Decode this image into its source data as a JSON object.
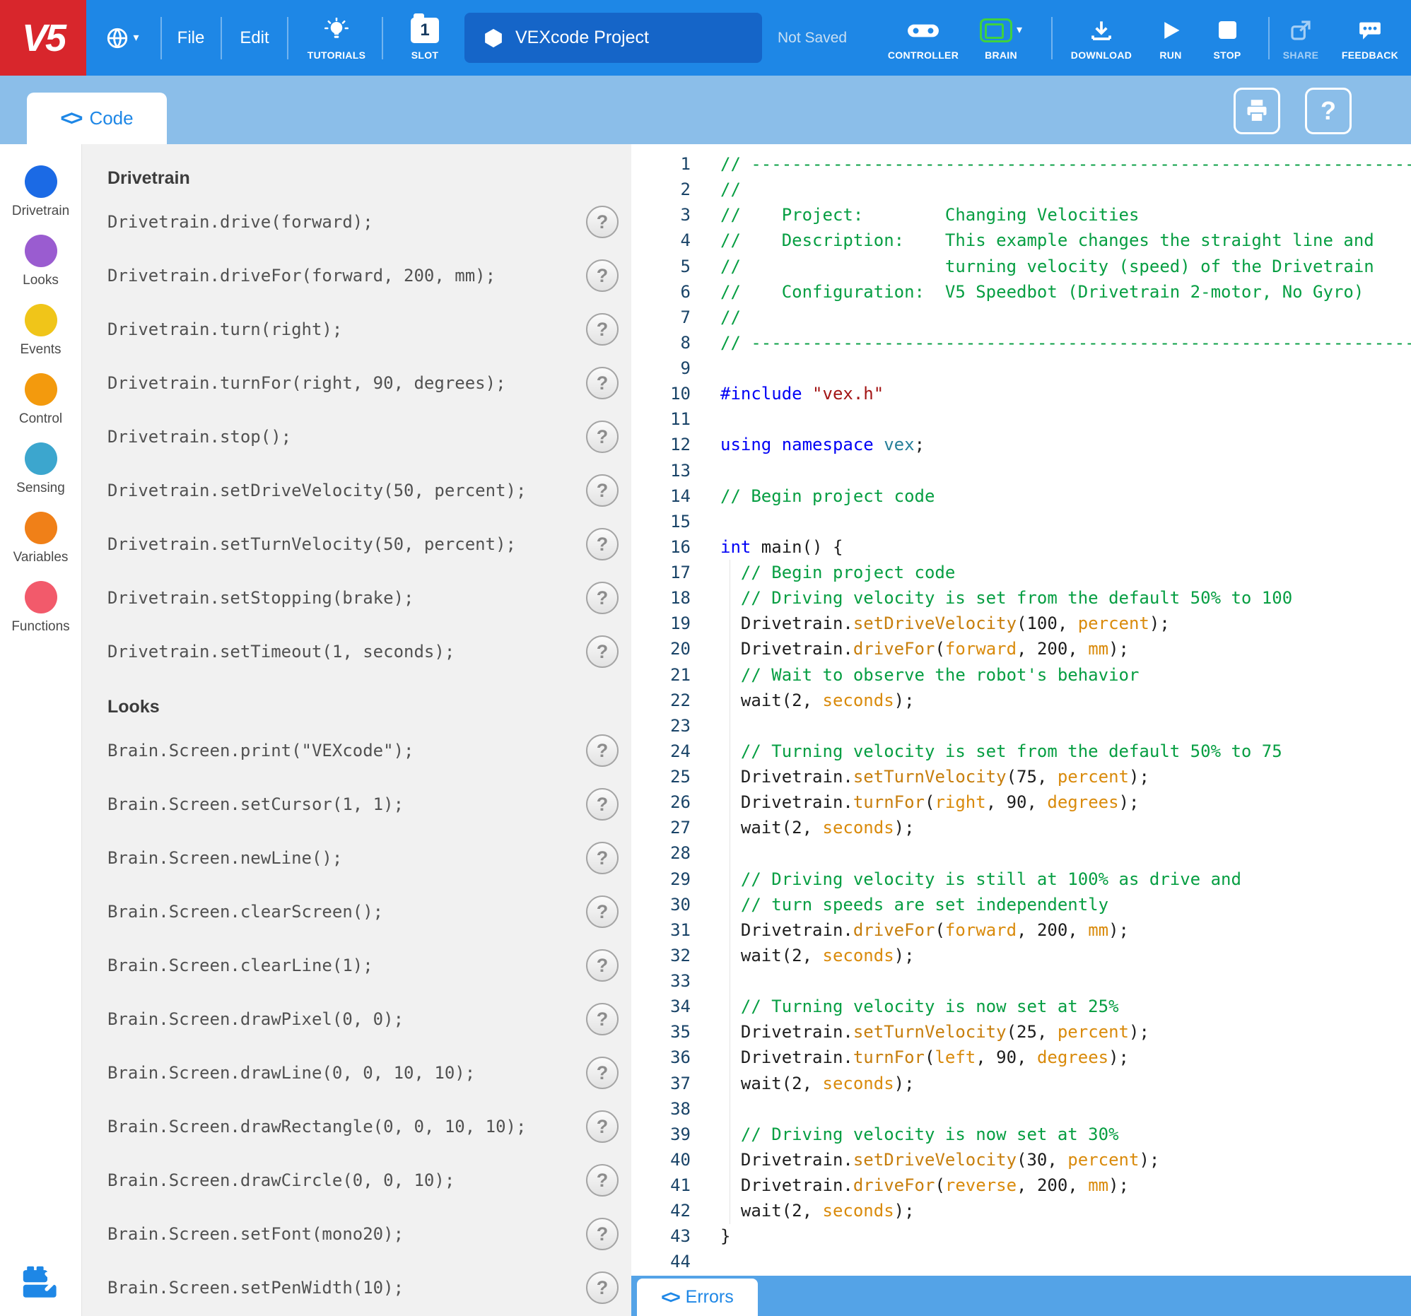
{
  "colors": {
    "toolbar_blue": "#1E87E6",
    "logo_red": "#D8262C",
    "project_box_blue": "#1565C8",
    "subbar_blue": "#8BBEE9",
    "errors_bar_blue": "#54A3E7",
    "brain_green": "#3FD23F",
    "accent_blue": "#1E87E6"
  },
  "toolbar": {
    "logo_text": "V5",
    "file_menu": "File",
    "edit_menu": "Edit",
    "tutorials_label": "TUTORIALS",
    "slot_label": "SLOT",
    "slot_number": "1",
    "project_title": "VEXcode Project",
    "save_status": "Not Saved",
    "controller_label": "CONTROLLER",
    "brain_label": "BRAIN",
    "download_label": "DOWNLOAD",
    "run_label": "RUN",
    "stop_label": "STOP",
    "share_label": "SHARE",
    "feedback_label": "FEEDBACK"
  },
  "workspace_bar": {
    "code_tab_label": "Code"
  },
  "icons": {
    "help_glyph": "?",
    "angle_brackets_glyph": "<>",
    "caret_down_glyph": "▾"
  },
  "palette": {
    "categories": [
      {
        "label": "Drivetrain",
        "color": "#1B6AE5"
      },
      {
        "label": "Looks",
        "color": "#9A5CD0"
      },
      {
        "label": "Events",
        "color": "#F0C519"
      },
      {
        "label": "Control",
        "color": "#F39A0D"
      },
      {
        "label": "Sensing",
        "color": "#3CA6CE"
      },
      {
        "label": "Variables",
        "color": "#F08018"
      },
      {
        "label": "Functions",
        "color": "#F25A6B"
      }
    ]
  },
  "commands": {
    "sections": [
      {
        "title": "Drivetrain",
        "items": [
          "Drivetrain.drive(forward);",
          "Drivetrain.driveFor(forward, 200, mm);",
          "Drivetrain.turn(right);",
          "Drivetrain.turnFor(right, 90, degrees);",
          "Drivetrain.stop();",
          "Drivetrain.setDriveVelocity(50, percent);",
          "Drivetrain.setTurnVelocity(50, percent);",
          "Drivetrain.setStopping(brake);",
          "Drivetrain.setTimeout(1, seconds);"
        ]
      },
      {
        "title": "Looks",
        "items": [
          "Brain.Screen.print(\"VEXcode\");",
          "Brain.Screen.setCursor(1, 1);",
          "Brain.Screen.newLine();",
          "Brain.Screen.clearScreen();",
          "Brain.Screen.clearLine(1);",
          "Brain.Screen.drawPixel(0, 0);",
          "Brain.Screen.drawLine(0, 0, 10, 10);",
          "Brain.Screen.drawRectangle(0, 0, 10, 10);",
          "Brain.Screen.drawCircle(0, 0, 10);",
          "Brain.Screen.setFont(mono20);",
          "Brain.Screen.setPenWidth(10);"
        ]
      }
    ]
  },
  "editor": {
    "syntax_colors": {
      "plain": "#1E1E1E",
      "comment": "#069E42",
      "keyword": "#0000F5",
      "string": "#A31515",
      "type": "#267F99",
      "method": "#C77E0C",
      "argument": "#D98A0B"
    },
    "lines": [
      [
        [
          "c",
          "// ----------------------------------------------------------------------------------------------------"
        ]
      ],
      [
        [
          "c",
          "//"
        ]
      ],
      [
        [
          "c",
          "//    Project:        Changing Velocities"
        ]
      ],
      [
        [
          "c",
          "//    Description:    This example changes the straight line and"
        ]
      ],
      [
        [
          "c",
          "//                    turning velocity (speed) of the Drivetrain"
        ]
      ],
      [
        [
          "c",
          "//    Configuration:  V5 Speedbot (Drivetrain 2-motor, No Gyro)"
        ]
      ],
      [
        [
          "c",
          "//"
        ]
      ],
      [
        [
          "c",
          "// ----------------------------------------------------------------------------------------------------"
        ]
      ],
      [],
      [
        [
          "k",
          "#include"
        ],
        [
          "p",
          " "
        ],
        [
          "s",
          "\"vex.h\""
        ]
      ],
      [],
      [
        [
          "k",
          "using"
        ],
        [
          "p",
          " "
        ],
        [
          "k",
          "namespace"
        ],
        [
          "p",
          " "
        ],
        [
          "t",
          "vex"
        ],
        [
          "p",
          ";"
        ]
      ],
      [],
      [
        [
          "c",
          "// Begin project code"
        ]
      ],
      [],
      [
        [
          "k",
          "int"
        ],
        [
          "p",
          " main() {"
        ]
      ],
      [
        [
          "c",
          "  // Begin project code"
        ]
      ],
      [
        [
          "c",
          "  // Driving velocity is set from the default 50% to 100"
        ]
      ],
      [
        [
          "p",
          "  Drivetrain."
        ],
        [
          "m",
          "setDriveVelocity"
        ],
        [
          "p",
          "(100, "
        ],
        [
          "a",
          "percent"
        ],
        [
          "p",
          ");"
        ]
      ],
      [
        [
          "p",
          "  Drivetrain."
        ],
        [
          "m",
          "driveFor"
        ],
        [
          "p",
          "("
        ],
        [
          "a",
          "forward"
        ],
        [
          "p",
          ", 200, "
        ],
        [
          "a",
          "mm"
        ],
        [
          "p",
          ");"
        ]
      ],
      [
        [
          "c",
          "  // Wait to observe the robot's behavior"
        ]
      ],
      [
        [
          "p",
          "  wait(2, "
        ],
        [
          "a",
          "seconds"
        ],
        [
          "p",
          ");"
        ]
      ],
      [],
      [
        [
          "c",
          "  // Turning velocity is set from the default 50% to 75"
        ]
      ],
      [
        [
          "p",
          "  Drivetrain."
        ],
        [
          "m",
          "setTurnVelocity"
        ],
        [
          "p",
          "(75, "
        ],
        [
          "a",
          "percent"
        ],
        [
          "p",
          ");"
        ]
      ],
      [
        [
          "p",
          "  Drivetrain."
        ],
        [
          "m",
          "turnFor"
        ],
        [
          "p",
          "("
        ],
        [
          "a",
          "right"
        ],
        [
          "p",
          ", 90, "
        ],
        [
          "a",
          "degrees"
        ],
        [
          "p",
          ");"
        ]
      ],
      [
        [
          "p",
          "  wait(2, "
        ],
        [
          "a",
          "seconds"
        ],
        [
          "p",
          ");"
        ]
      ],
      [],
      [
        [
          "c",
          "  // Driving velocity is still at 100% as drive and"
        ]
      ],
      [
        [
          "c",
          "  // turn speeds are set independently"
        ]
      ],
      [
        [
          "p",
          "  Drivetrain."
        ],
        [
          "m",
          "driveFor"
        ],
        [
          "p",
          "("
        ],
        [
          "a",
          "forward"
        ],
        [
          "p",
          ", 200, "
        ],
        [
          "a",
          "mm"
        ],
        [
          "p",
          ");"
        ]
      ],
      [
        [
          "p",
          "  wait(2, "
        ],
        [
          "a",
          "seconds"
        ],
        [
          "p",
          ");"
        ]
      ],
      [],
      [
        [
          "c",
          "  // Turning velocity is now set at 25%"
        ]
      ],
      [
        [
          "p",
          "  Drivetrain."
        ],
        [
          "m",
          "setTurnVelocity"
        ],
        [
          "p",
          "(25, "
        ],
        [
          "a",
          "percent"
        ],
        [
          "p",
          ");"
        ]
      ],
      [
        [
          "p",
          "  Drivetrain."
        ],
        [
          "m",
          "turnFor"
        ],
        [
          "p",
          "("
        ],
        [
          "a",
          "left"
        ],
        [
          "p",
          ", 90, "
        ],
        [
          "a",
          "degrees"
        ],
        [
          "p",
          ");"
        ]
      ],
      [
        [
          "p",
          "  wait(2, "
        ],
        [
          "a",
          "seconds"
        ],
        [
          "p",
          ");"
        ]
      ],
      [],
      [
        [
          "c",
          "  // Driving velocity is now set at 30%"
        ]
      ],
      [
        [
          "p",
          "  Drivetrain."
        ],
        [
          "m",
          "setDriveVelocity"
        ],
        [
          "p",
          "(30, "
        ],
        [
          "a",
          "percent"
        ],
        [
          "p",
          ");"
        ]
      ],
      [
        [
          "p",
          "  Drivetrain."
        ],
        [
          "m",
          "driveFor"
        ],
        [
          "p",
          "("
        ],
        [
          "a",
          "reverse"
        ],
        [
          "p",
          ", 200, "
        ],
        [
          "a",
          "mm"
        ],
        [
          "p",
          ");"
        ]
      ],
      [
        [
          "p",
          "  wait(2, "
        ],
        [
          "a",
          "seconds"
        ],
        [
          "p",
          ");"
        ]
      ],
      [
        [
          "p",
          "}"
        ]
      ],
      []
    ]
  },
  "errors_bar": {
    "label": "Errors"
  }
}
